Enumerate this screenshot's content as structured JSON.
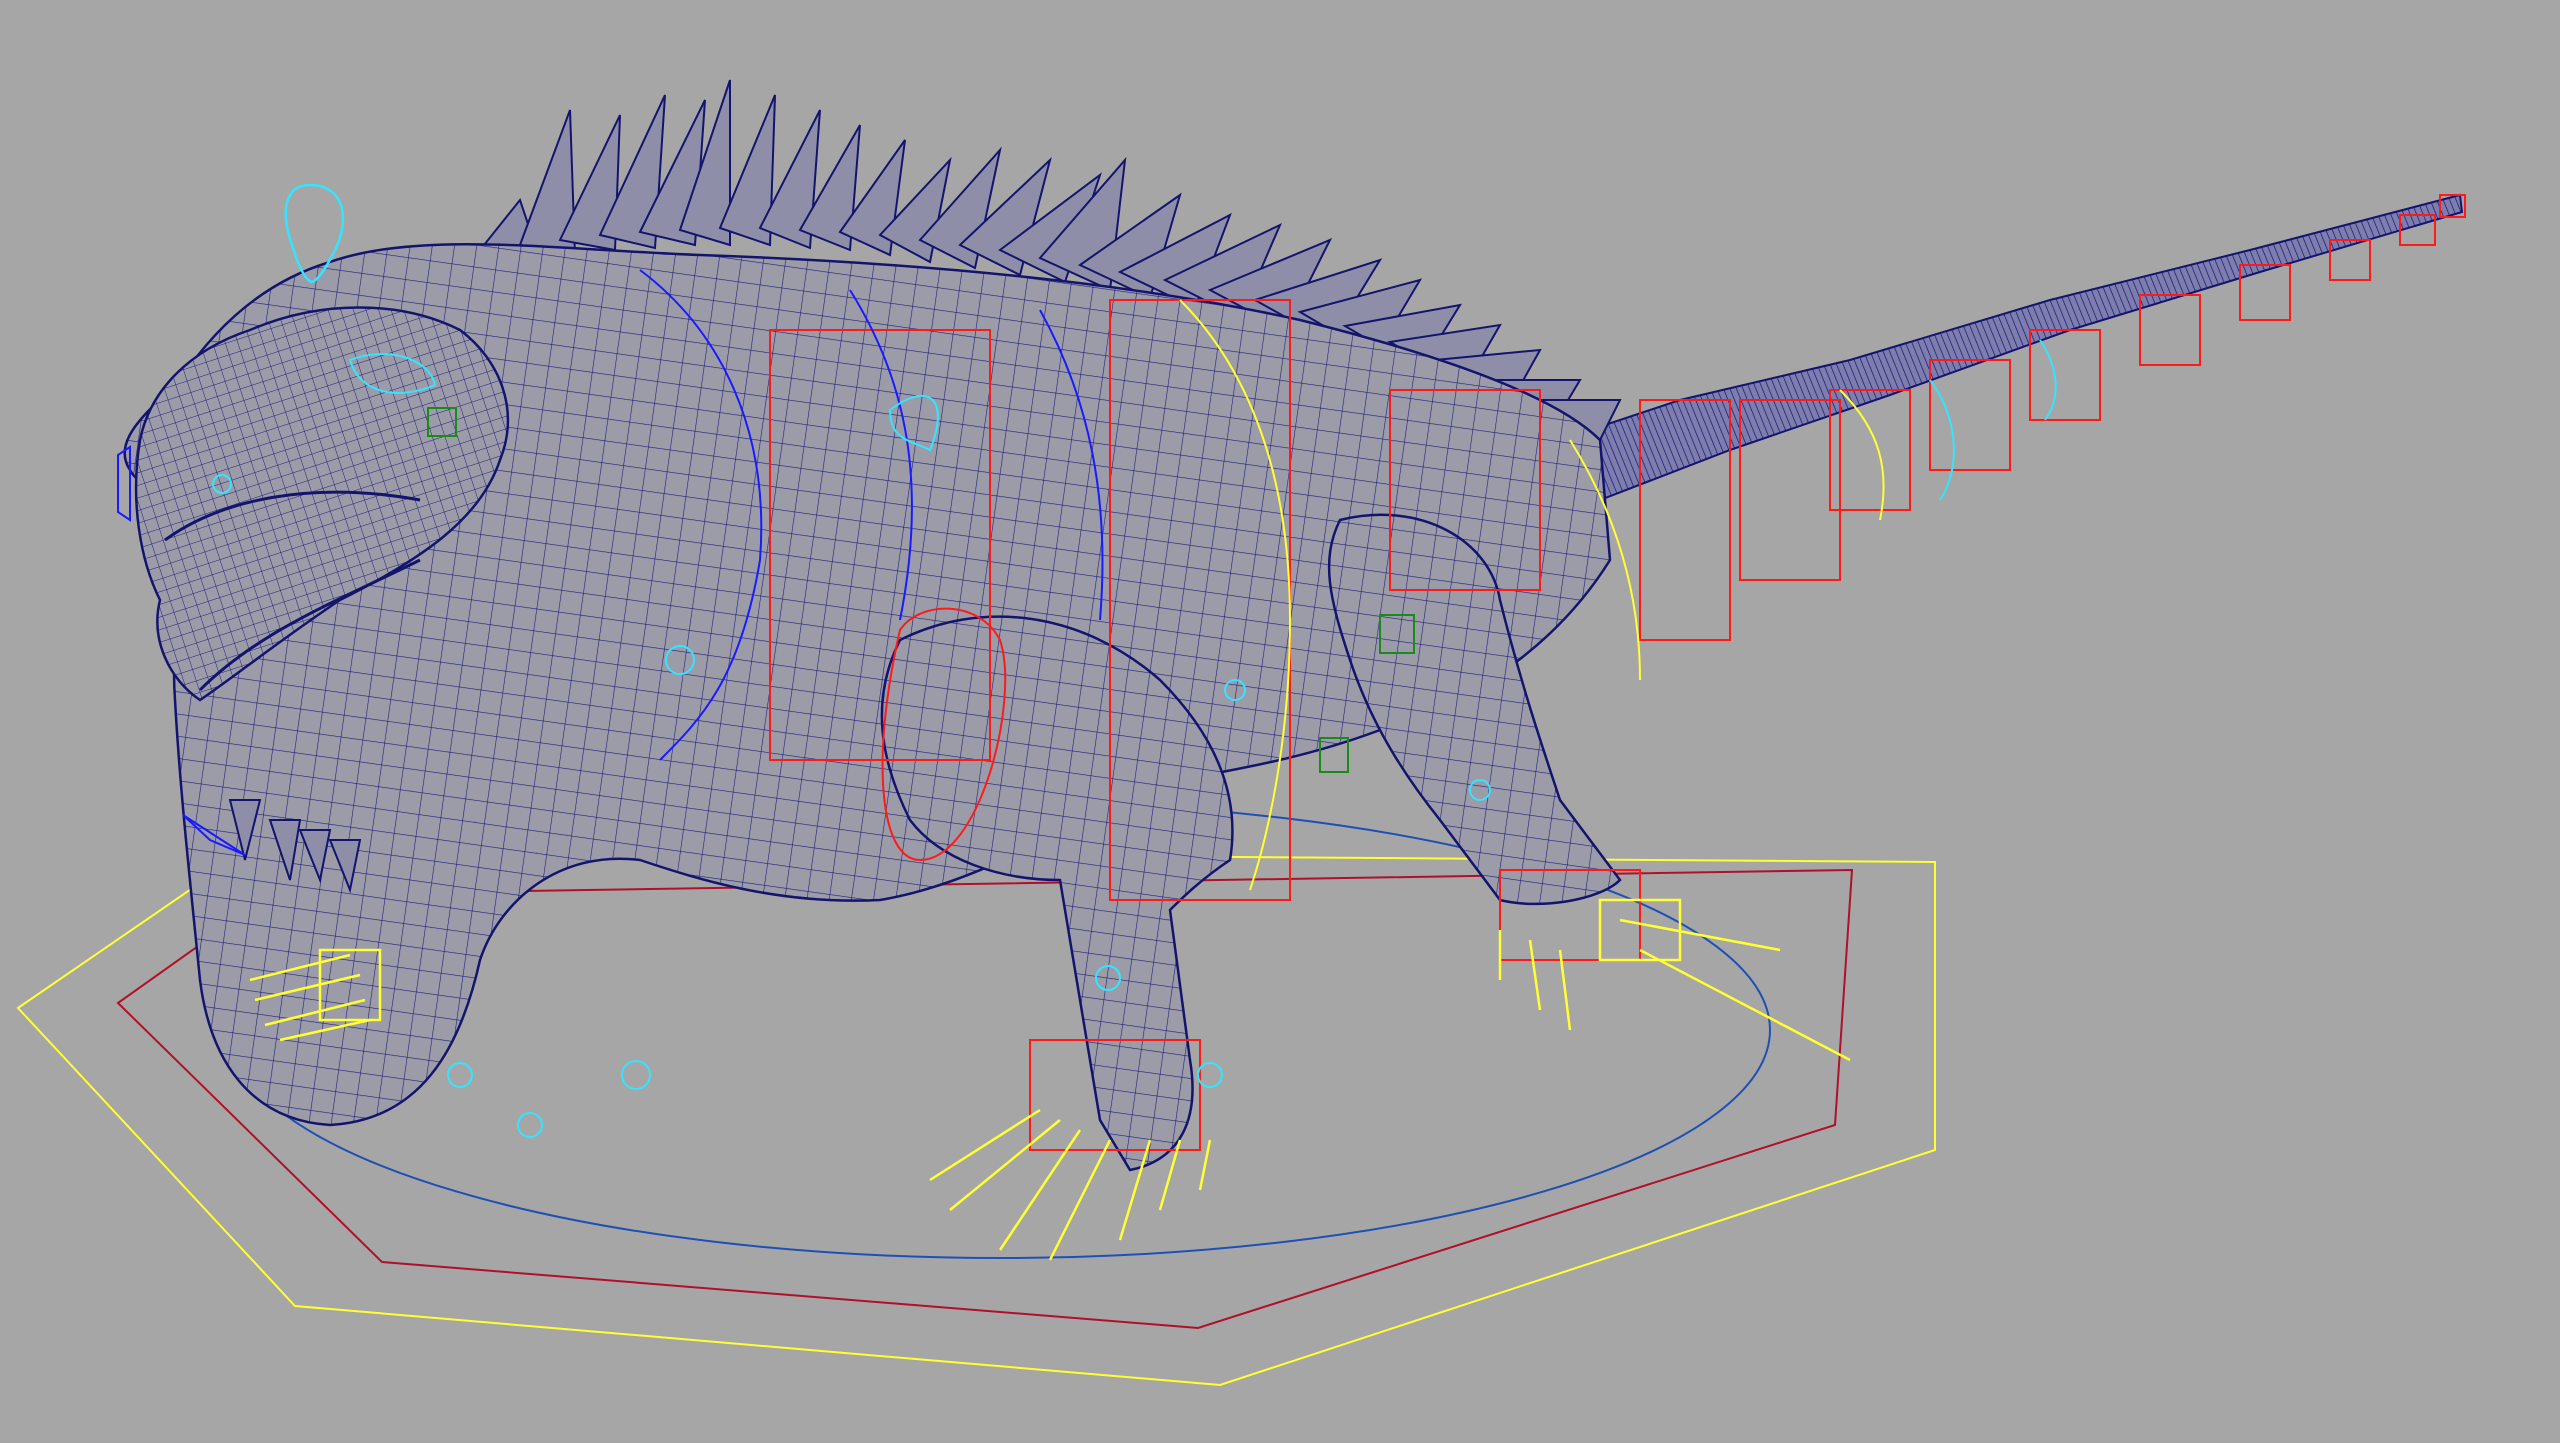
{
  "viewport": {
    "background": "#a6a6a6",
    "display_mode": "wireframe",
    "subject": "iguana-rig"
  },
  "colors": {
    "mesh_wire": "#1e1e7a",
    "mesh_fill": "#9a9aa6",
    "fk_controls": "#ff1a1a",
    "ik_controls": "#ffff33",
    "blue_curves": "#1a1aff",
    "cyan_controls": "#33e5ff",
    "green_controls": "#1a8a1a",
    "root_outer": "#ffff33",
    "root_middle": "#b0102a",
    "root_inner": "#1e50b4"
  },
  "icons": {
    "look_at_control": "teardrop-icon",
    "locator": "sphere-locator-icon",
    "pivot_box": "cube-control-icon"
  }
}
